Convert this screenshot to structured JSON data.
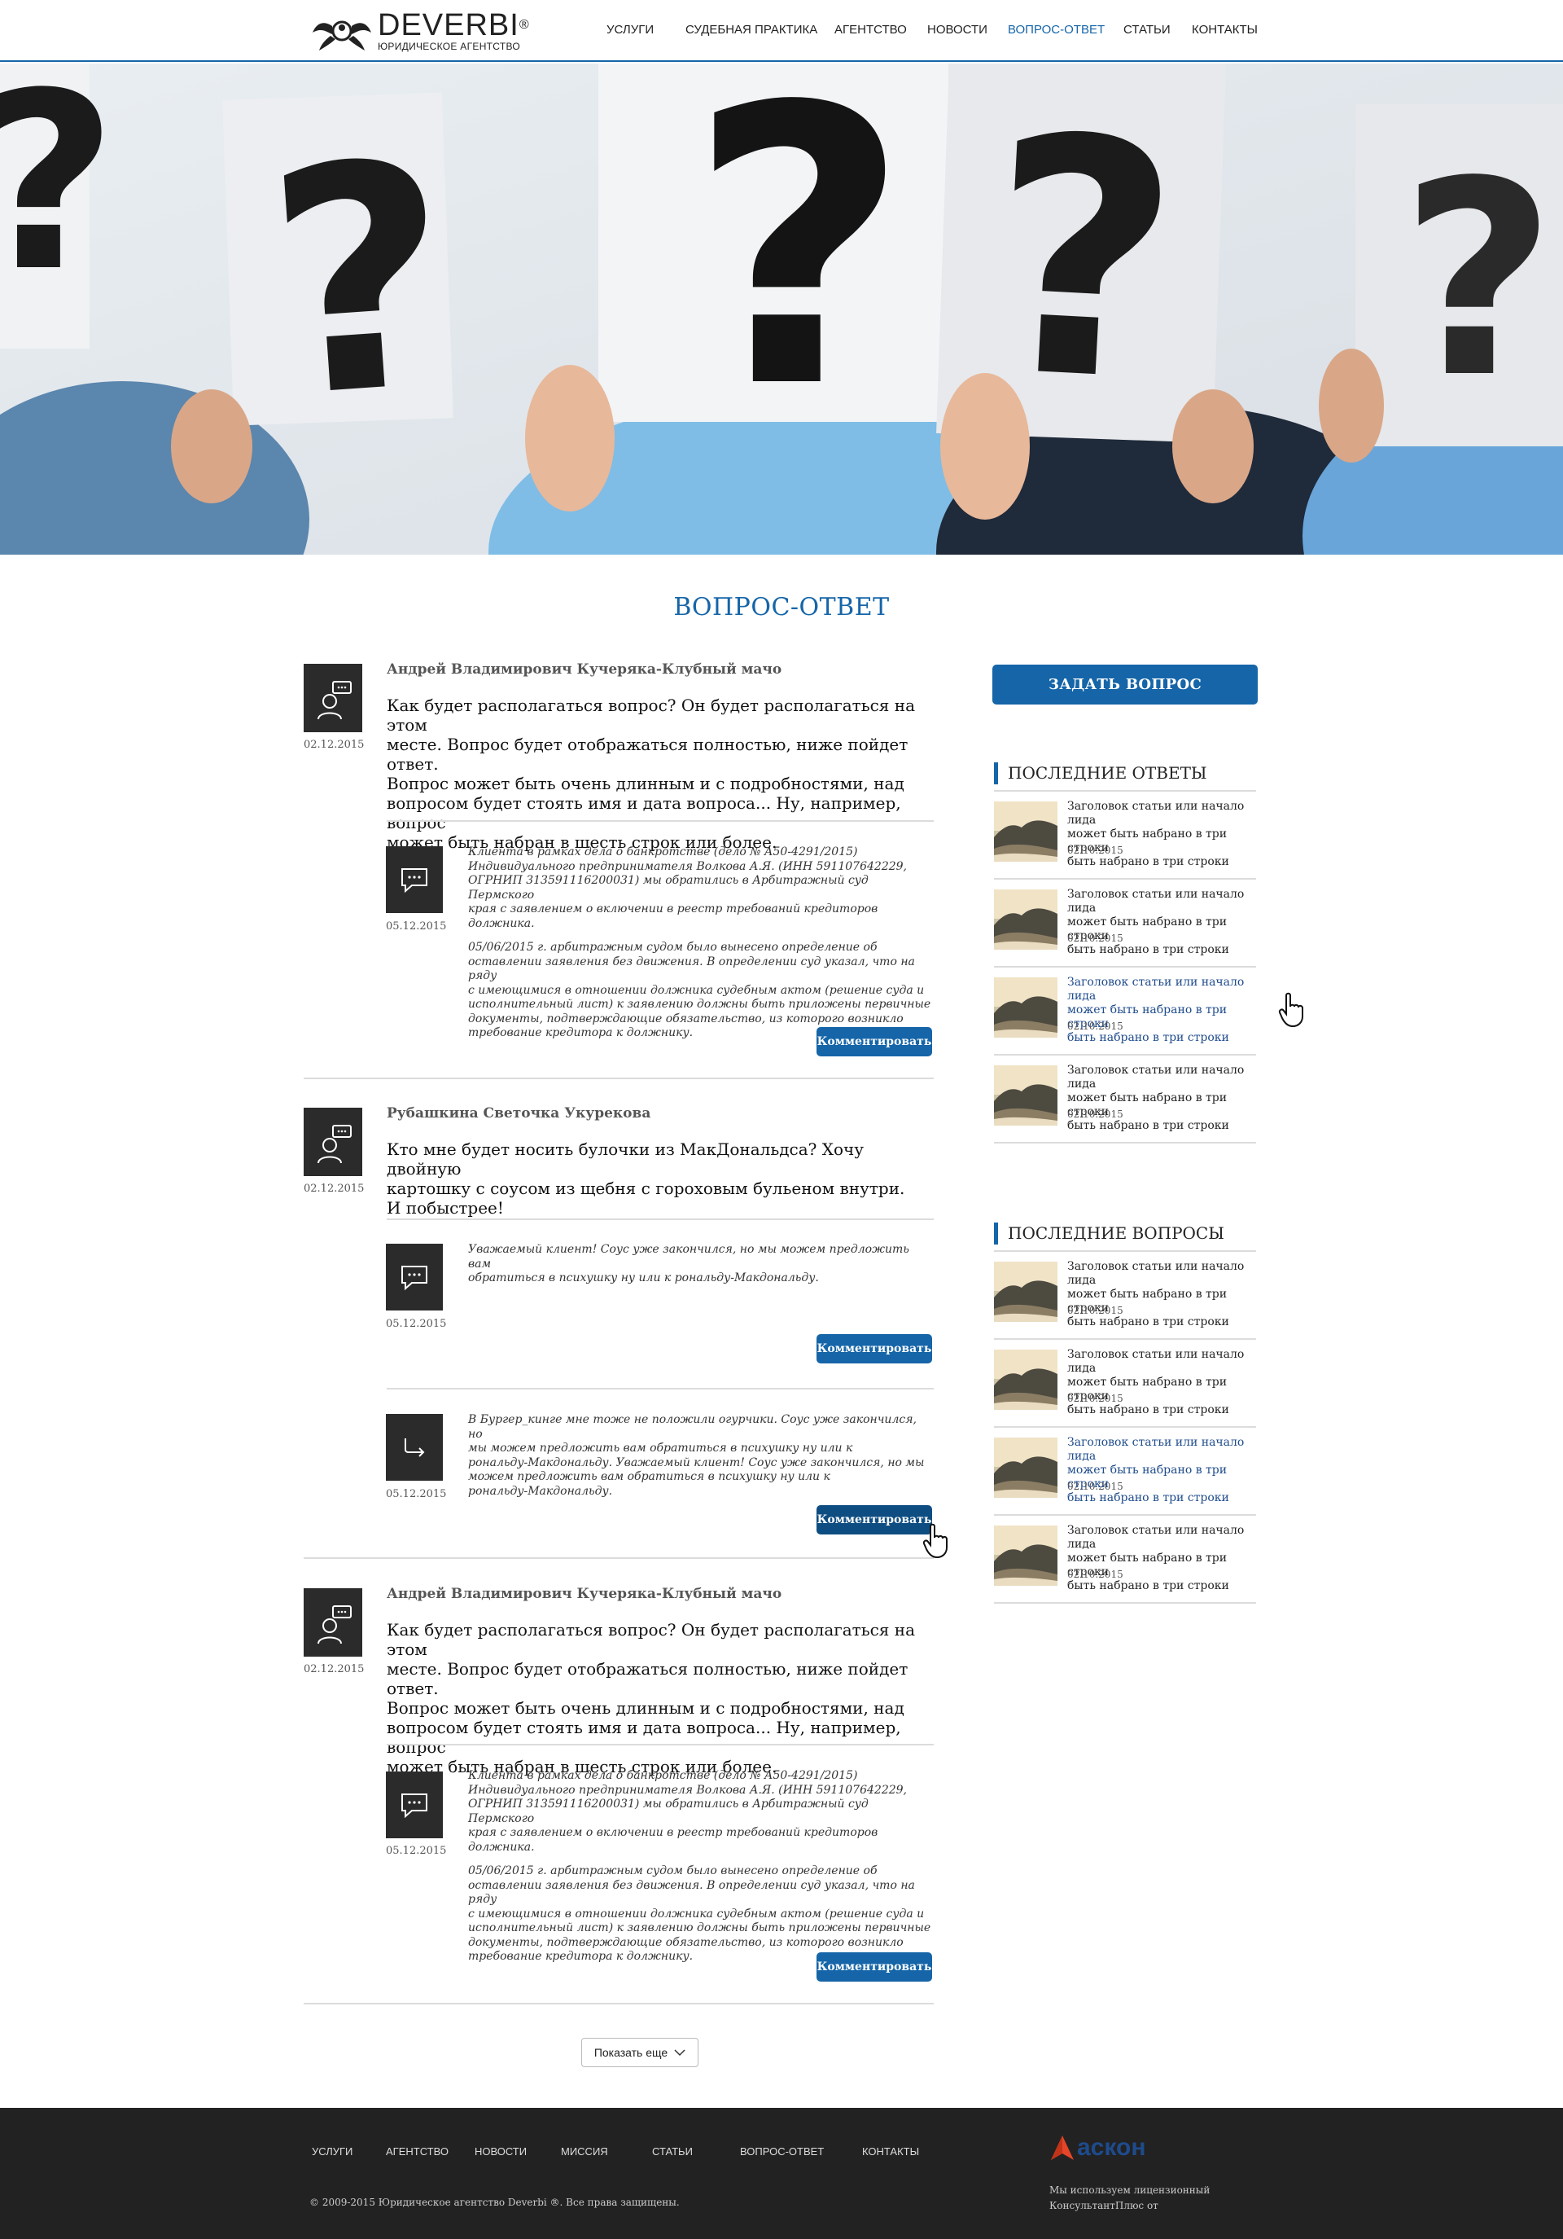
{
  "header": {
    "logo_name": "DEVERBI",
    "logo_reg": "®",
    "logo_sub": "ЮРИДИЧЕСКОЕ АГЕНТСТВО",
    "nav": [
      "УСЛУГИ",
      "СУДЕБНАЯ ПРАКТИКА",
      "АГЕНТСТВО",
      "НОВОСТИ",
      "ВОПРОС-ОТВЕТ",
      "СТАТЬИ",
      "КОНТАКТЫ"
    ],
    "active_nav": "ВОПРОС-ОТВЕТ"
  },
  "page_title": "ВОПРОС-ОТВЕТ",
  "questions": [
    {
      "author": "Андрей Владимирович Кучеряка-Клубный мачо",
      "date": "02.12.2015",
      "text": [
        "Как будет располагаться вопрос? Он будет располагаться на этом",
        "месте. Вопрос будет отображаться полностью, ниже пойдет ответ.",
        "Вопрос может быть очень длинным и с подробностями, над",
        "вопросом будет стоять имя и дата вопроса... Ну, например, вопрос",
        "может быть набран в шесть строк или более."
      ],
      "answers": [
        {
          "date": "05.12.2015",
          "icon": "speech-bubble-icon",
          "text": [
            "Клиента в рамках дела о банкротстве (дело № А50-4291/2015)",
            "Индивидуального предпринимателя Волкова А.Я. (ИНН 591107642229,",
            "ОГРНИП 313591116200031) мы обратились в Арбитражный суд Пермского",
            "края с заявлением о включении в реестр требований кредиторов должника.",
            "",
            "05/06/2015 г. арбитражным судом было вынесено определение об",
            "оставлении заявления без движения. В определении суд указал, что на ряду",
            "с имеющимися в отношении должника судебным актом (решение суда и",
            "исполнительный лист) к заявлению должны быть приложены первичные",
            "документы, подтверждающие обязательство, из которого возникло",
            "требование кредитора к должнику."
          ],
          "button": "Комментировать"
        }
      ]
    },
    {
      "author": "Рубашкина Светочка Укурекова",
      "date": "02.12.2015",
      "text": [
        "Кто мне будет носить булочки из МакДональдса? Хочу двойную",
        "картошку с соусом из щебня с гороховым бульеном внутри.",
        "И побыстрее!"
      ],
      "answers": [
        {
          "date": "05.12.2015",
          "icon": "speech-bubble-icon",
          "text": [
            "Уважаемый клиент! Соус уже закончился, но мы можем предложить вам",
            "обратиться в психушку ну или к рональду-Макдональду."
          ],
          "button": "Комментировать"
        },
        {
          "date": "05.12.2015",
          "icon": "reply-arrow-icon",
          "text": [
            "В Бургер_кинге мне тоже не положили огурчики.  Соус уже закончился, но",
            "мы можем предложить вам обратиться в психушку ну или к",
            "рональду-Макдональду. Уважаемый клиент! Соус уже закончился, но мы",
            "можем предложить вам обратиться в психушку ну или к",
            "рональду-Макдональду."
          ],
          "button": "Комментировать"
        }
      ]
    },
    {
      "author": "Андрей Владимирович Кучеряка-Клубный мачо",
      "date": "02.12.2015",
      "text": [
        "Как будет располагаться вопрос? Он будет располагаться на этом",
        "месте. Вопрос будет отображаться полностью, ниже пойдет ответ.",
        "Вопрос может быть очень длинным и с подробностями, над",
        "вопросом будет стоять имя и дата вопроса... Ну, например, вопрос",
        "может быть набран в шесть строк или более."
      ],
      "answers": [
        {
          "date": "05.12.2015",
          "icon": "speech-bubble-icon",
          "text": [
            "Клиента в рамках дела о банкротстве (дело № А50-4291/2015)",
            "Индивидуального предпринимателя Волкова А.Я. (ИНН 591107642229,",
            "ОГРНИП 313591116200031) мы обратились в Арбитражный суд Пермского",
            "края с заявлением о включении в реестр требований кредиторов должника.",
            "",
            "05/06/2015 г. арбитражным судом было вынесено определение об",
            "оставлении заявления без движения. В определении суд указал, что на ряду",
            "с имеющимися в отношении должника судебным актом (решение суда и",
            "исполнительный лист) к заявлению должны быть приложены первичные",
            "документы, подтверждающие обязательство, из которого возникло",
            "требование кредитора к должнику."
          ],
          "button": "Комментировать"
        }
      ]
    }
  ],
  "sidebar": {
    "ask_button": "ЗАДАТЬ ВОПРОС",
    "recent_answers_title": "ПОСЛЕДНИЕ ОТВЕТЫ",
    "recent_questions_title": "ПОСЛЕДНИЕ ВОПРОСЫ",
    "recent_answers": [
      {
        "title": [
          "Заголовок статьи или  начало лида",
          "может быть набрано в три строки",
          "быть набрано в три строки"
        ],
        "date": "02.10.2015",
        "hovered": false
      },
      {
        "title": [
          "Заголовок статьи или  начало лида",
          "может быть набрано в три строки",
          "быть набрано в три строки"
        ],
        "date": "02.10.2015",
        "hovered": false
      },
      {
        "title": [
          "Заголовок статьи или  начало лида",
          "может быть набрано в три строки",
          "быть набрано в три строки"
        ],
        "date": "02.10.2015",
        "hovered": true
      },
      {
        "title": [
          "Заголовок статьи или  начало лида",
          "может быть набрано в три строки",
          "быть набрано в три строки"
        ],
        "date": "02.10.2015",
        "hovered": false
      }
    ],
    "recent_questions": [
      {
        "title": [
          "Заголовок статьи или  начало лида",
          "может быть набрано в три строки",
          "быть набрано в три строки"
        ],
        "date": "02.10.2015",
        "hovered": false
      },
      {
        "title": [
          "Заголовок статьи или  начало лида",
          "может быть набрано в три строки",
          "быть набрано в три строки"
        ],
        "date": "02.10.2015",
        "hovered": false
      },
      {
        "title": [
          "Заголовок статьи или  начало лида",
          "может быть набрано в три строки",
          "быть набрано в три строки"
        ],
        "date": "02.10.2015",
        "hovered": true
      },
      {
        "title": [
          "Заголовок статьи или  начало лида",
          "может быть набрано в три строки",
          "быть набрано в три строки"
        ],
        "date": "02.10.2015",
        "hovered": false
      }
    ]
  },
  "show_more": "Показать еще",
  "footer": {
    "nav": [
      "УСЛУГИ",
      "АГЕНТСТВО",
      "НОВОСТИ",
      "МИССИЯ",
      "СТАТЬИ",
      "ВОПРОС-ОТВЕТ",
      "КОНТАКТЫ"
    ],
    "copyright": "© 2009-2015 Юридическое агентство Deverbi ®. Все права защищены.",
    "partner_logo": "аскон",
    "license": [
      "Мы используем лицензионный",
      "КонсультантПлюс от"
    ]
  },
  "colors": {
    "accent": "#1565a8",
    "dark_button": "#0e4d82",
    "footer_bg": "#222222",
    "icon_bg": "#2b2b2b"
  }
}
